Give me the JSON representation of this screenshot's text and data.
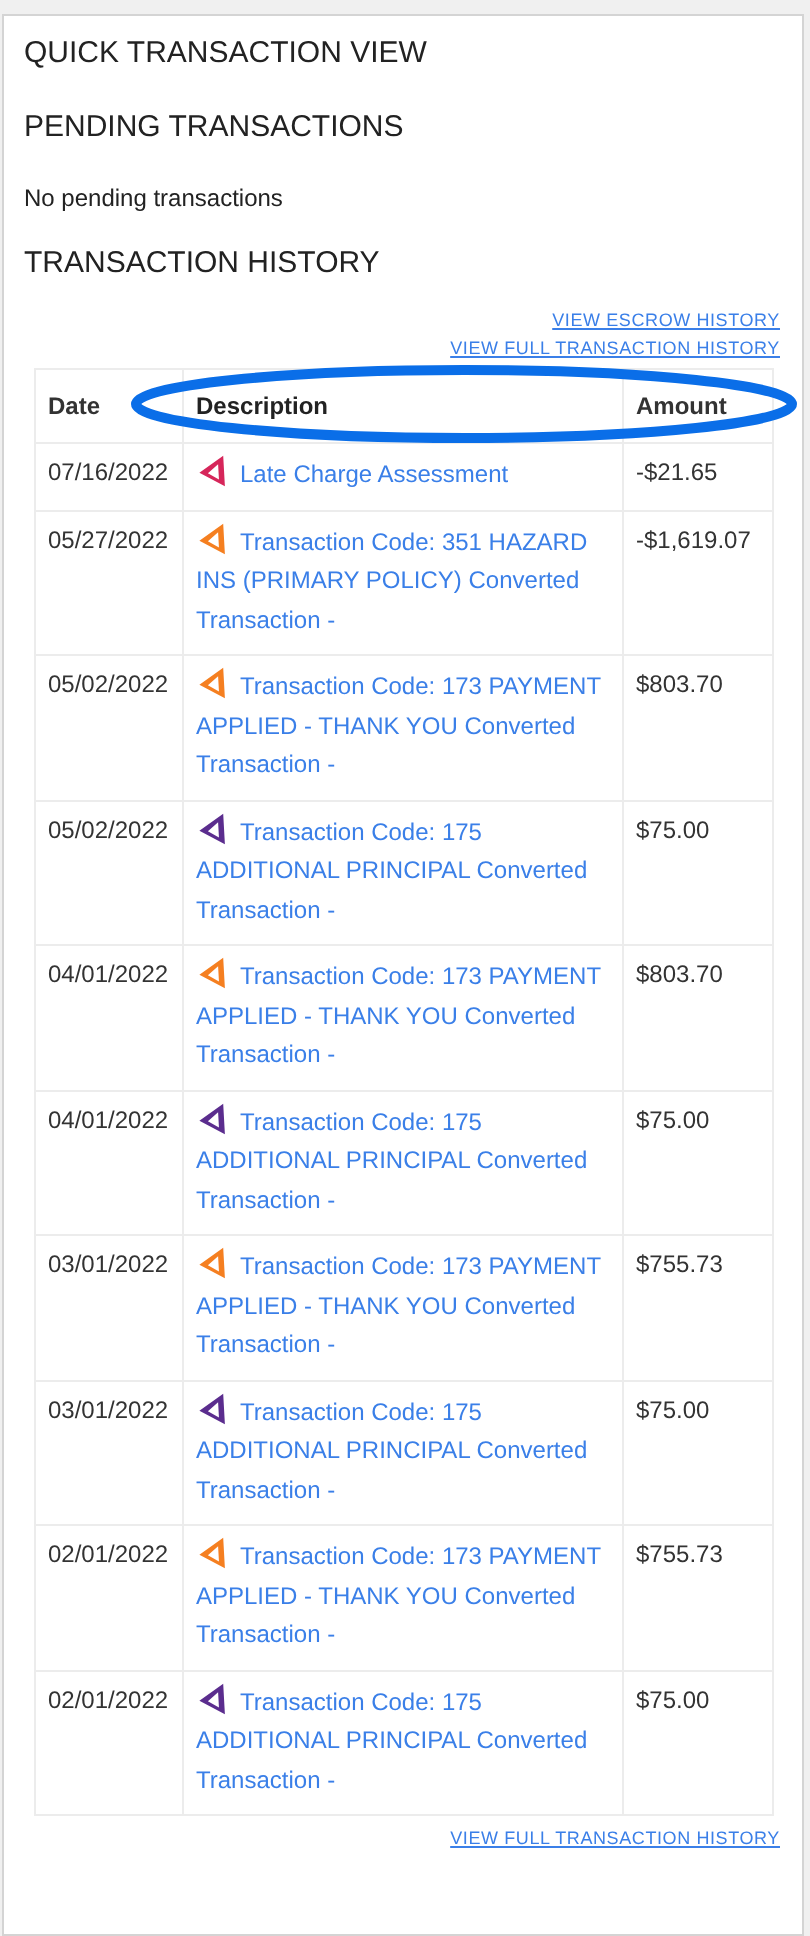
{
  "title": "QUICK TRANSACTION VIEW",
  "pending": {
    "heading": "PENDING TRANSACTIONS",
    "message": "No pending transactions"
  },
  "history": {
    "heading": "TRANSACTION HISTORY",
    "links": [
      "VIEW ESCROW HISTORY",
      "VIEW FULL TRANSACTION HISTORY"
    ],
    "columns": [
      "Date",
      "Description",
      "Amount"
    ],
    "rows": [
      {
        "date": "07/16/2022",
        "description": "Late Charge Assessment",
        "amount": "-$21.65",
        "color": "#d6265a"
      },
      {
        "date": "05/27/2022",
        "description": "Transaction Code: 351 HAZARD INS (PRIMARY POLICY) Converted Transaction -",
        "amount": "-$1,619.07",
        "color": "#f57f20"
      },
      {
        "date": "05/02/2022",
        "description": "Transaction Code: 173 PAYMENT APPLIED - THANK YOU Converted Transaction -",
        "amount": "$803.70",
        "color": "#f57f20"
      },
      {
        "date": "05/02/2022",
        "description": "Transaction Code: 175 ADDITIONAL PRINCIPAL Converted Transaction -",
        "amount": "$75.00",
        "color": "#5b2d8e"
      },
      {
        "date": "04/01/2022",
        "description": "Transaction Code: 173 PAYMENT APPLIED - THANK YOU Converted Transaction -",
        "amount": "$803.70",
        "color": "#f57f20"
      },
      {
        "date": "04/01/2022",
        "description": "Transaction Code: 175 ADDITIONAL PRINCIPAL Converted Transaction -",
        "amount": "$75.00",
        "color": "#5b2d8e"
      },
      {
        "date": "03/01/2022",
        "description": "Transaction Code: 173 PAYMENT APPLIED - THANK YOU Converted Transaction -",
        "amount": "$755.73",
        "color": "#f57f20"
      },
      {
        "date": "03/01/2022",
        "description": "Transaction Code: 175 ADDITIONAL PRINCIPAL Converted Transaction -",
        "amount": "$75.00",
        "color": "#5b2d8e"
      },
      {
        "date": "02/01/2022",
        "description": "Transaction Code: 173 PAYMENT APPLIED - THANK YOU Converted Transaction -",
        "amount": "$755.73",
        "color": "#f57f20"
      },
      {
        "date": "02/01/2022",
        "description": "Transaction Code: 175 ADDITIONAL PRINCIPAL Converted Transaction -",
        "amount": "$75.00",
        "color": "#5b2d8e"
      }
    ],
    "footer_link": "VIEW FULL TRANSACTION HISTORY"
  }
}
